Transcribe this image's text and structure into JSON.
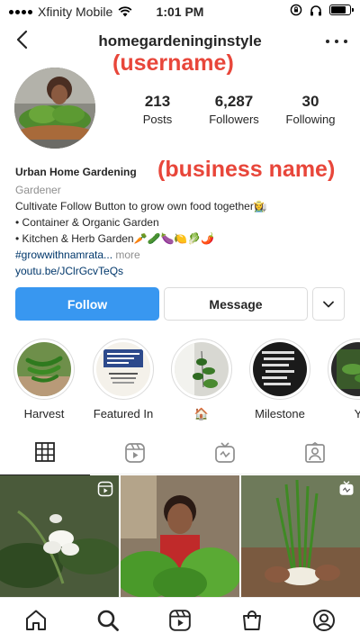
{
  "status_bar": {
    "carrier": "Xfinity Mobile",
    "time": "1:01 PM",
    "icons": [
      "signal-icon",
      "wifi-icon",
      "lock-rotation-icon",
      "headphones-icon",
      "battery-icon"
    ],
    "battery_level": 0.8
  },
  "header": {
    "username": "homegardeninginstyle",
    "icons": [
      "chevron-left-icon",
      "more-options-icon"
    ]
  },
  "annotations": {
    "username": "(username)",
    "business_name": "(business name)",
    "color": "#e8463a"
  },
  "stats": [
    {
      "value": "213",
      "label": "Posts"
    },
    {
      "value": "6,287",
      "label": "Followers"
    },
    {
      "value": "30",
      "label": "Following"
    }
  ],
  "bio": {
    "business_name": "Urban Home Gardening",
    "category": "Gardener",
    "line1": "Cultivate Follow Button to grow own food together👩‍🌾",
    "line2": "• Container & Organic Garden",
    "line3": "• Kitchen & Herb Garden🥕🥒🍆🍋🥬🌶️",
    "hashtag": "#growwithnamrata...",
    "more": " more",
    "link": "youtu.be/JClrGcvTeQs"
  },
  "actions": {
    "follow": "Follow",
    "message": "Message",
    "dropdown_icon": "chevron-down-icon"
  },
  "highlights": [
    {
      "label": "Harvest"
    },
    {
      "label": "Featured In"
    },
    {
      "label": "🏠"
    },
    {
      "label": "Milestone"
    },
    {
      "label": "Y"
    }
  ],
  "tabs": [
    "grid-icon",
    "reels-icon",
    "igtv-icon",
    "tagged-icon"
  ],
  "bottom_nav": [
    "home-icon",
    "search-icon",
    "reels-icon",
    "shop-icon",
    "profile-icon"
  ],
  "colors": {
    "primary_button": "#3897f0",
    "link": "#00376b",
    "muted_text": "#8e8e8e",
    "border": "#dbdbdb"
  }
}
